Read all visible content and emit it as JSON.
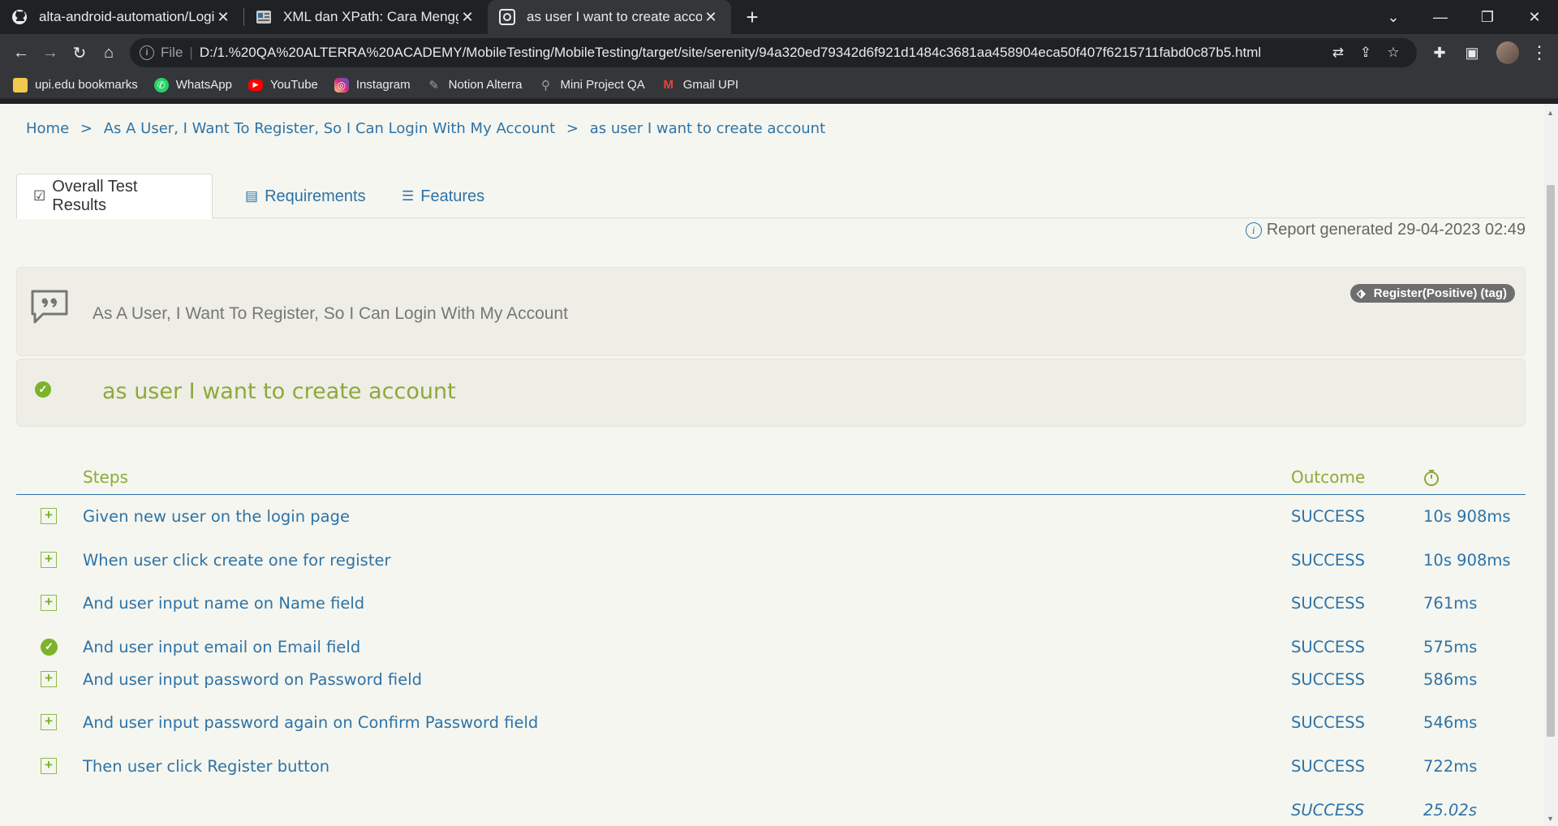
{
  "browser": {
    "tabs": [
      {
        "title": "alta-android-automation/LoginSt",
        "icon": "github-icon"
      },
      {
        "title": "XML dan XPath: Cara Menggunak",
        "icon": "article-icon"
      },
      {
        "title": "as user I want to create account",
        "icon": "serenity-icon",
        "active": true
      }
    ],
    "url": {
      "scheme": "File",
      "path": "D:/1.%20QA%20ALTERRA%20ACADEMY/MobileTesting/MobileTesting/target/site/serenity/94a320ed79342d6f921d1484c3681aa458904eca50f407f6215711fabd0c87b5.html"
    },
    "bookmarks": [
      {
        "label": "upi.edu bookmarks",
        "icon": "folder-icon",
        "color": "#f2c94c"
      },
      {
        "label": "WhatsApp",
        "icon": "whatsapp-icon",
        "color": "#25d366"
      },
      {
        "label": "YouTube",
        "icon": "youtube-icon",
        "color": "#ff0000"
      },
      {
        "label": "Instagram",
        "icon": "instagram-icon",
        "color": "#d62976"
      },
      {
        "label": "Notion Alterra",
        "icon": "pencil-icon",
        "color": "#9aa0a6"
      },
      {
        "label": "Mini Project QA",
        "icon": "magnifier-icon",
        "color": "#9aa0a6"
      },
      {
        "label": "Gmail UPI",
        "icon": "gmail-icon",
        "color": "#ea4335"
      }
    ]
  },
  "page": {
    "breadcrumb": {
      "home": "Home",
      "sep1": ">",
      "story": "As A User, I Want To Register, So I Can Login With My Account",
      "sep2": ">",
      "current": "as user I want to create account"
    },
    "tabs": {
      "overall": "Overall Test Results",
      "requirements": "Requirements",
      "features": "Features"
    },
    "report_generated": "Report generated 29-04-2023 02:49",
    "story": {
      "title": "As A User, I Want To Register, So I Can Login With My Account",
      "tag": "Register(Positive) (tag)"
    },
    "scenario": {
      "title": "as user I want to create account",
      "status": "success"
    },
    "steps_table": {
      "headers": {
        "steps": "Steps",
        "outcome": "Outcome",
        "duration_icon": "stopwatch-icon"
      },
      "rows": [
        {
          "description": "Given new user on the login page",
          "outcome": "SUCCESS",
          "duration": "10s 908ms",
          "marker": "expand"
        },
        {
          "description": "When user click create one for register",
          "outcome": "SUCCESS",
          "duration": "10s 908ms",
          "marker": "expand"
        },
        {
          "description": "And user input name on Name field",
          "outcome": "SUCCESS",
          "duration": "761ms",
          "marker": "expand"
        },
        {
          "description": "And user input email on Email field",
          "outcome": "SUCCESS",
          "duration": "575ms",
          "marker": "check"
        },
        {
          "description": "And user input password on Password field",
          "outcome": "SUCCESS",
          "duration": "586ms",
          "marker": "expand"
        },
        {
          "description": "And user input password again on Confirm Password field",
          "outcome": "SUCCESS",
          "duration": "546ms",
          "marker": "expand"
        },
        {
          "description": "Then user click Register button",
          "outcome": "SUCCESS",
          "duration": "722ms",
          "marker": "expand"
        }
      ],
      "total": {
        "outcome": "SUCCESS",
        "duration": "25.02s"
      }
    }
  },
  "colors": {
    "link_blue": "#2d73a8",
    "success_green": "#7cb32b",
    "heading_green": "#8da93a",
    "page_bg": "#f5f6ef"
  }
}
